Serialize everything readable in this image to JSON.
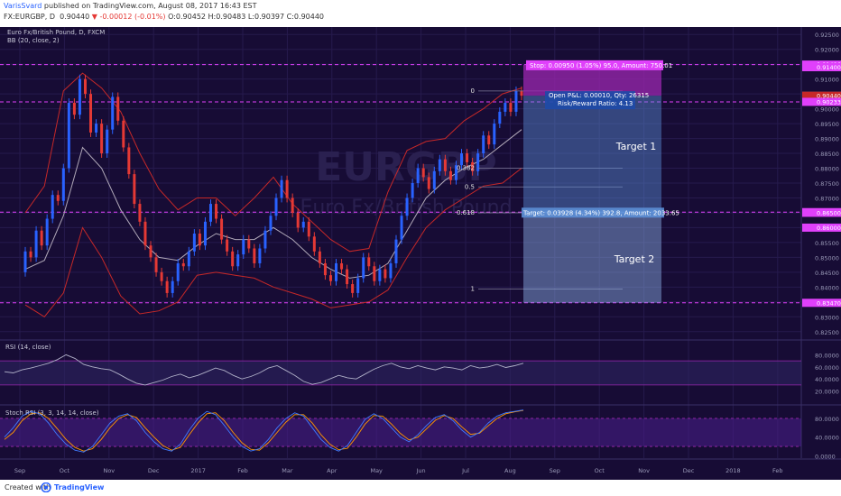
{
  "header": {
    "author": "VarisSvard",
    "published": "published on TradingView.com, August 08, 2017 16:43 EST",
    "symbol": "FX:EURGBP, D",
    "price": "0.90440",
    "change": "-0.00012 (-0.01%)",
    "ohlc": "O:0.90452 H:0.90483 L:0.90397 C:0.90440"
  },
  "footer": {
    "created_with": "Created with",
    "brand": "TradingView"
  },
  "chart_data": [
    {
      "type": "candlestick",
      "title": "Euro Fx/British Pound, D, FXCM",
      "indicator": "BB (20, close, 2)",
      "watermark": "EURGBP",
      "watermark_sub": "Euro Fx/British Pound",
      "ylim": [
        0.8225,
        0.9275
      ],
      "y_ticks": [
        "0.92500",
        "0.92000",
        "0.91500",
        "0.91000",
        "0.90500",
        "0.90000",
        "0.89500",
        "0.89000",
        "0.88500",
        "0.88000",
        "0.87500",
        "0.87000",
        "0.86500",
        "0.86000",
        "0.85500",
        "0.85000",
        "0.84500",
        "0.84000",
        "0.83500",
        "0.83000",
        "0.82500"
      ],
      "x_ticks": [
        "Sep",
        "Oct",
        "Nov",
        "Dec",
        "2017",
        "Feb",
        "Mar",
        "Apr",
        "May",
        "Jun",
        "Jul",
        "Aug",
        "Sep",
        "Oct",
        "Nov",
        "Dec",
        "2018",
        "Feb"
      ],
      "candles": [
        [
          0.845,
          0.852
        ],
        [
          0.852,
          0.85
        ],
        [
          0.85,
          0.859
        ],
        [
          0.859,
          0.854
        ],
        [
          0.854,
          0.863
        ],
        [
          0.863,
          0.871
        ],
        [
          0.871,
          0.869
        ],
        [
          0.869,
          0.88
        ],
        [
          0.88,
          0.902
        ],
        [
          0.902,
          0.898
        ],
        [
          0.898,
          0.91
        ],
        [
          0.91,
          0.905
        ],
        [
          0.905,
          0.892
        ],
        [
          0.892,
          0.895
        ],
        [
          0.895,
          0.885
        ],
        [
          0.885,
          0.893
        ],
        [
          0.893,
          0.904
        ],
        [
          0.904,
          0.896
        ],
        [
          0.896,
          0.887
        ],
        [
          0.887,
          0.878
        ],
        [
          0.878,
          0.868
        ],
        [
          0.868,
          0.862
        ],
        [
          0.862,
          0.854
        ],
        [
          0.854,
          0.85
        ],
        [
          0.85,
          0.845
        ],
        [
          0.845,
          0.842
        ],
        [
          0.842,
          0.838
        ],
        [
          0.838,
          0.842
        ],
        [
          0.842,
          0.848
        ],
        [
          0.848,
          0.847
        ],
        [
          0.847,
          0.852
        ],
        [
          0.852,
          0.858
        ],
        [
          0.858,
          0.854
        ],
        [
          0.854,
          0.862
        ],
        [
          0.862,
          0.868
        ],
        [
          0.868,
          0.863
        ],
        [
          0.863,
          0.856
        ],
        [
          0.856,
          0.852
        ],
        [
          0.852,
          0.847
        ],
        [
          0.847,
          0.851
        ],
        [
          0.851,
          0.856
        ],
        [
          0.856,
          0.853
        ],
        [
          0.853,
          0.848
        ],
        [
          0.848,
          0.853
        ],
        [
          0.853,
          0.859
        ],
        [
          0.859,
          0.864
        ],
        [
          0.864,
          0.87
        ],
        [
          0.87,
          0.876
        ],
        [
          0.876,
          0.87
        ],
        [
          0.87,
          0.865
        ],
        [
          0.865,
          0.86
        ],
        [
          0.86,
          0.862
        ],
        [
          0.862,
          0.857
        ],
        [
          0.857,
          0.852
        ],
        [
          0.852,
          0.848
        ],
        [
          0.848,
          0.844
        ],
        [
          0.844,
          0.842
        ],
        [
          0.842,
          0.848
        ],
        [
          0.848,
          0.846
        ],
        [
          0.846,
          0.841
        ],
        [
          0.841,
          0.838
        ],
        [
          0.838,
          0.843
        ],
        [
          0.843,
          0.85
        ],
        [
          0.85,
          0.847
        ],
        [
          0.847,
          0.842
        ],
        [
          0.842,
          0.846
        ],
        [
          0.846,
          0.843
        ],
        [
          0.843,
          0.848
        ],
        [
          0.848,
          0.856
        ],
        [
          0.856,
          0.864
        ],
        [
          0.864,
          0.87
        ],
        [
          0.87,
          0.875
        ],
        [
          0.875,
          0.88
        ],
        [
          0.88,
          0.877
        ],
        [
          0.877,
          0.873
        ],
        [
          0.873,
          0.879
        ],
        [
          0.879,
          0.883
        ],
        [
          0.883,
          0.879
        ],
        [
          0.879,
          0.876
        ],
        [
          0.876,
          0.881
        ],
        [
          0.881,
          0.885
        ],
        [
          0.885,
          0.882
        ],
        [
          0.882,
          0.879
        ],
        [
          0.879,
          0.885
        ],
        [
          0.885,
          0.891
        ],
        [
          0.891,
          0.888
        ],
        [
          0.888,
          0.895
        ],
        [
          0.895,
          0.899
        ],
        [
          0.899,
          0.902
        ],
        [
          0.902,
          0.899
        ],
        [
          0.899,
          0.906
        ],
        [
          0.906,
          0.9044
        ]
      ],
      "bb_upper": [
        0.865,
        0.874,
        0.906,
        0.912,
        0.907,
        0.899,
        0.885,
        0.873,
        0.866,
        0.87,
        0.87,
        0.864,
        0.87,
        0.877,
        0.868,
        0.862,
        0.856,
        0.852,
        0.853,
        0.872,
        0.886,
        0.889,
        0.89,
        0.896,
        0.9,
        0.905,
        0.907
      ],
      "bb_lower": [
        0.834,
        0.83,
        0.838,
        0.86,
        0.85,
        0.837,
        0.831,
        0.832,
        0.835,
        0.844,
        0.845,
        0.844,
        0.843,
        0.84,
        0.838,
        0.836,
        0.833,
        0.834,
        0.835,
        0.839,
        0.85,
        0.86,
        0.866,
        0.87,
        0.874,
        0.875,
        0.88
      ],
      "bb_basis": [
        0.846,
        0.849,
        0.864,
        0.887,
        0.88,
        0.866,
        0.856,
        0.85,
        0.849,
        0.854,
        0.858,
        0.856,
        0.856,
        0.86,
        0.856,
        0.85,
        0.846,
        0.843,
        0.844,
        0.848,
        0.859,
        0.87,
        0.876,
        0.88,
        0.883,
        0.888,
        0.893
      ],
      "fib_levels": [
        {
          "label": "0",
          "price": 0.906
        },
        {
          "label": "0.382",
          "price": 0.88
        },
        {
          "label": "0.5",
          "price": 0.8737
        },
        {
          "label": "0.618",
          "price": 0.865
        },
        {
          "label": "1",
          "price": 0.8393
        }
      ],
      "horizontal_levels": [
        0.91486,
        0.90233,
        0.86522,
        0.8347
      ],
      "price_labels": [
        {
          "text": "0.91486",
          "price": 0.91486,
          "color": "#e040fb"
        },
        {
          "text": "0.91400",
          "price": 0.914,
          "color": "#e040fb"
        },
        {
          "text": "0.90450",
          "price": 0.9045,
          "color": "#1e2a55"
        },
        {
          "text": "0.90440",
          "price": 0.9044,
          "color": "#c62828"
        },
        {
          "text": "0.90233",
          "price": 0.90233,
          "color": "#e040fb"
        },
        {
          "text": "0.86522",
          "price": 0.86522,
          "color": "#e040fb"
        },
        {
          "text": "0.86500",
          "price": 0.865,
          "color": "#e040fb"
        },
        {
          "text": "0.86000",
          "price": 0.86,
          "color": "#e040fb"
        },
        {
          "text": "0.83470",
          "price": 0.8347,
          "color": "#e040fb"
        }
      ],
      "position": {
        "stop_label": "Stop: 0.00950 (1.05%) 95.0, Amount: 750.01",
        "open_label_1": "Open P&L: 0.00010, Qty: 26315",
        "open_label_2": "Risk/Reward Ratio: 4.13",
        "target_label": "Target: 0.03928 (4.34%) 392.8, Amount: 2033.65",
        "entry": 0.9044,
        "stop": 0.9148,
        "target": 0.8652,
        "final_target": 0.8347,
        "target1_text": "Target 1",
        "target2_text": "Target 2"
      }
    },
    {
      "type": "line",
      "title": "RSI (14, close)",
      "ylim": [
        0,
        100
      ],
      "y_ticks": [
        "80.0000",
        "60.0000",
        "40.0000",
        "20.0000"
      ],
      "upper_band": 70,
      "lower_band": 30,
      "values": [
        52,
        50,
        55,
        58,
        62,
        66,
        72,
        80,
        74,
        64,
        60,
        57,
        55,
        48,
        40,
        33,
        30,
        34,
        38,
        44,
        48,
        42,
        46,
        52,
        58,
        54,
        46,
        40,
        44,
        50,
        58,
        62,
        54,
        46,
        36,
        31,
        34,
        40,
        46,
        42,
        40,
        48,
        56,
        62,
        66,
        60,
        57,
        62,
        58,
        55,
        60,
        58,
        55,
        62,
        58,
        60,
        64,
        59,
        62,
        66
      ]
    },
    {
      "type": "line",
      "title": "Stoch RSI (3, 3, 14, 14, close)",
      "ylim": [
        -5,
        105
      ],
      "y_ticks": [
        "80.0000",
        "40.0000",
        "0.0000"
      ],
      "upper_band": 80,
      "lower_band": 20,
      "values": [
        40,
        60,
        85,
        95,
        90,
        70,
        45,
        25,
        12,
        8,
        20,
        45,
        70,
        85,
        90,
        75,
        50,
        30,
        15,
        10,
        25,
        55,
        80,
        95,
        88,
        65,
        40,
        20,
        10,
        15,
        35,
        60,
        80,
        92,
        85,
        60,
        35,
        18,
        10,
        22,
        50,
        78,
        90,
        80,
        60,
        40,
        30,
        45,
        65,
        82,
        88,
        75,
        55,
        40,
        50,
        70,
        85,
        92,
        95,
        98
      ],
      "values_d": [
        35,
        50,
        75,
        90,
        92,
        80,
        58,
        35,
        18,
        10,
        15,
        35,
        60,
        80,
        88,
        82,
        60,
        40,
        22,
        12,
        18,
        45,
        70,
        90,
        92,
        75,
        50,
        28,
        14,
        12,
        28,
        50,
        72,
        88,
        88,
        70,
        45,
        25,
        13,
        16,
        40,
        68,
        86,
        85,
        68,
        48,
        34,
        40,
        58,
        76,
        86,
        80,
        62,
        46,
        48,
        64,
        80,
        90,
        94,
        97
      ]
    }
  ]
}
